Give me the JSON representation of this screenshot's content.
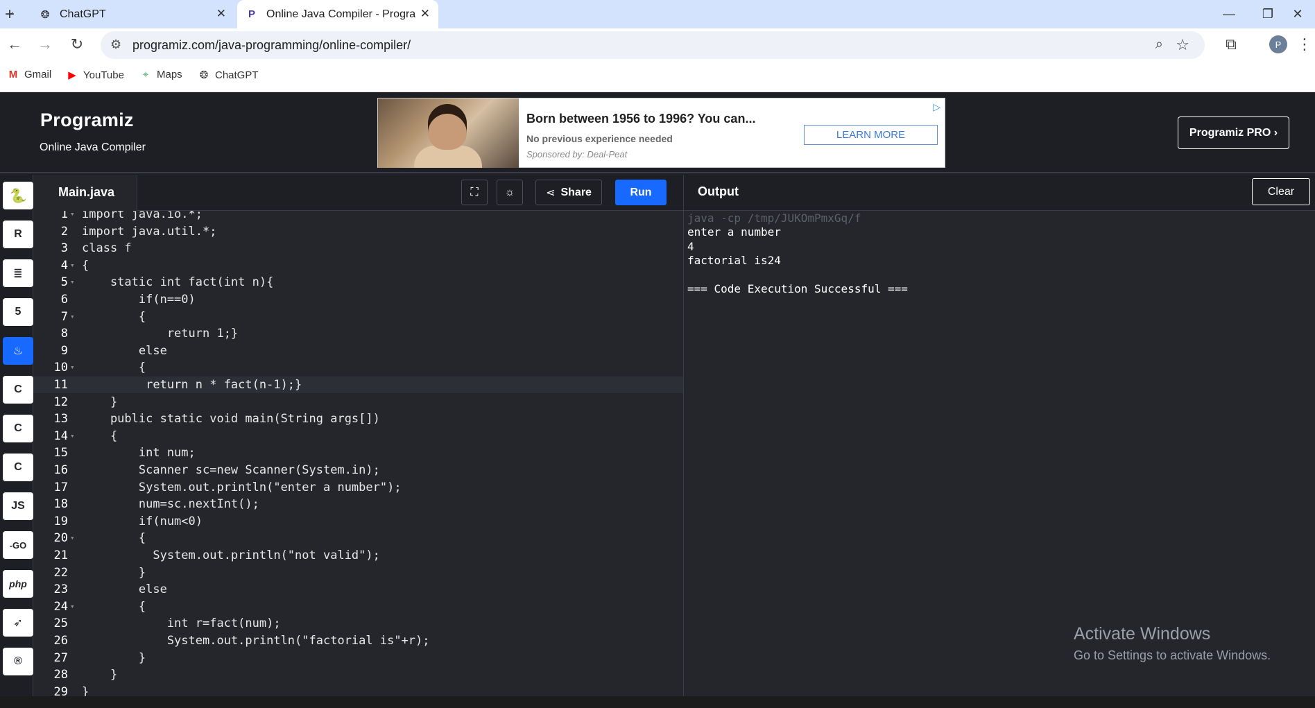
{
  "browser": {
    "tabs": [
      {
        "title": "ChatGPT",
        "icon": "openai-icon"
      },
      {
        "title": "Online Java Compiler - Program",
        "icon": "programiz-icon",
        "active": true
      }
    ],
    "new_tab_label": "+",
    "url": "programiz.com/java-programming/online-compiler/",
    "bookmarks": [
      {
        "label": "Gmail",
        "icon": "gmail-icon"
      },
      {
        "label": "YouTube",
        "icon": "youtube-icon"
      },
      {
        "label": "Maps",
        "icon": "maps-icon"
      },
      {
        "label": "ChatGPT",
        "icon": "openai-icon"
      }
    ],
    "profile_initial": "P"
  },
  "site": {
    "logo": "Programiz",
    "subtitle": "Online Java Compiler",
    "pro_button": "Programiz PRO ›"
  },
  "ad": {
    "title": "Born between 1956 to 1996? You can...",
    "description": "No previous experience needed",
    "sponsor": "Sponsored by: Deal-Peat",
    "cta": "LEARN MORE"
  },
  "editor": {
    "file_name": "Main.java",
    "share_label": "Share",
    "run_label": "Run",
    "active_line": 11,
    "lines": [
      {
        "n": "1",
        "text": "import java.io.*;",
        "fold": true
      },
      {
        "n": "2",
        "text": "import java.util.*;"
      },
      {
        "n": "3",
        "text": "class f"
      },
      {
        "n": "4",
        "text": "{",
        "fold": true
      },
      {
        "n": "5",
        "text": "    static int fact(int n){",
        "fold": true
      },
      {
        "n": "6",
        "text": "        if(n==0)"
      },
      {
        "n": "7",
        "text": "        {",
        "fold": true
      },
      {
        "n": "8",
        "text": "            return 1;}"
      },
      {
        "n": "9",
        "text": "        else"
      },
      {
        "n": "10",
        "text": "        {",
        "fold": true
      },
      {
        "n": "11",
        "text": "         return n * fact(n-1);}"
      },
      {
        "n": "12",
        "text": "    }"
      },
      {
        "n": "13",
        "text": "    public static void main(String args[])"
      },
      {
        "n": "14",
        "text": "    {",
        "fold": true
      },
      {
        "n": "15",
        "text": "        int num;"
      },
      {
        "n": "16",
        "text": "        Scanner sc=new Scanner(System.in);"
      },
      {
        "n": "17",
        "text": "        System.out.println(\"enter a number\");"
      },
      {
        "n": "18",
        "text": "        num=sc.nextInt();"
      },
      {
        "n": "19",
        "text": "        if(num<0)"
      },
      {
        "n": "20",
        "text": "        {",
        "fold": true
      },
      {
        "n": "21",
        "text": "          System.out.println(\"not valid\");"
      },
      {
        "n": "22",
        "text": "        }"
      },
      {
        "n": "23",
        "text": "        else"
      },
      {
        "n": "24",
        "text": "        {",
        "fold": true
      },
      {
        "n": "25",
        "text": "            int r=fact(num);"
      },
      {
        "n": "26",
        "text": "            System.out.println(\"factorial is\"+r);"
      },
      {
        "n": "27",
        "text": "        }"
      },
      {
        "n": "28",
        "text": "    }"
      },
      {
        "n": "29",
        "text": "}"
      }
    ]
  },
  "output": {
    "title": "Output",
    "clear_label": "Clear",
    "command": "java -cp /tmp/JUKOmPmxGq/f",
    "lines": [
      "enter a number",
      "4",
      "factorial is24",
      "",
      "=== Code Execution Successful ==="
    ]
  },
  "languages": [
    {
      "name": "python",
      "icon": "python-icon",
      "glyph": "🐍"
    },
    {
      "name": "r",
      "icon": "r-icon",
      "glyph": "R"
    },
    {
      "name": "sql",
      "icon": "database-icon",
      "glyph": "≡"
    },
    {
      "name": "html",
      "icon": "html5-icon",
      "glyph": "5"
    },
    {
      "name": "java",
      "icon": "java-icon",
      "glyph": "♨",
      "active": true
    },
    {
      "name": "c",
      "icon": "c-icon",
      "glyph": "C"
    },
    {
      "name": "cpp",
      "icon": "cpp-icon",
      "glyph": "C"
    },
    {
      "name": "csharp",
      "icon": "csharp-icon",
      "glyph": "C"
    },
    {
      "name": "javascript",
      "icon": "js-icon",
      "glyph": "JS"
    },
    {
      "name": "go",
      "icon": "go-icon",
      "glyph": "-GO"
    },
    {
      "name": "php",
      "icon": "php-icon",
      "glyph": "php"
    },
    {
      "name": "swift",
      "icon": "swift-icon",
      "glyph": "➶"
    },
    {
      "name": "rust",
      "icon": "rust-icon",
      "glyph": "R"
    }
  ],
  "watermark": {
    "line1": "Activate Windows",
    "line2": "Go to Settings to activate Windows."
  },
  "colors": {
    "accent": "#1769ff",
    "panel": "#25262b",
    "header": "#1d1f25"
  }
}
